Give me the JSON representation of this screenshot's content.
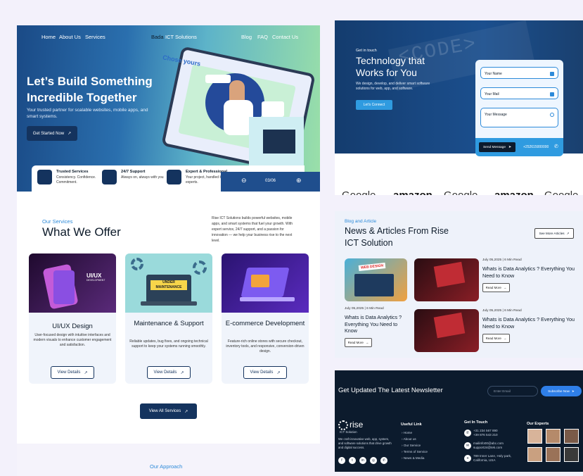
{
  "nav": {
    "home": "Home",
    "about": "About Us",
    "services": "Services",
    "brand_prefix": "Bada",
    "brand": "ICT Solutions",
    "blog": "Blog",
    "faq": "FAQ",
    "contact": "Contact Us"
  },
  "hero": {
    "title": "Let’s Build Something Incredible Together",
    "subtitle": "Your trusted partner for scalable websites, mobile apps, and smart systems.",
    "cta": "Get Started Now",
    "art_caption": "Chose yours"
  },
  "features": [
    {
      "title": "Trusted Services",
      "desc": "Consistency. Confidence. Commitment."
    },
    {
      "title": "24/7 Support",
      "desc": "Always on, always with you"
    },
    {
      "title": "Expert & Professional",
      "desc": "Your project, handled by experts."
    }
  ],
  "slider": {
    "counter": "03/06"
  },
  "services": {
    "tag": "Our Services",
    "title": "What We Offer",
    "intro": "Rise ICT Solutions builds powerful websites, mobile apps, and smart systems that fuel your growth. With expert service, 24/7 support, and a passion for innovation — we help your business rise to the next level.",
    "view_all": "View All Services",
    "cards": [
      {
        "title": "UI/UX Design",
        "desc": "User-focused design with intuitive interfaces and modern visuals to enhance customer engagement and satisfaction.",
        "button": "View Details",
        "img_label": "UI/UX",
        "img_sub": "DEVELOPMENT",
        "color": "#3a1550"
      },
      {
        "title": "Maintenance & Support",
        "desc": "Reliable updates, bug fixes, and ongoing technical support to keep your systems running smoothly.",
        "button": "View Details",
        "img_label": "UNDER MAINTENANCE",
        "color": "#8fd3d6"
      },
      {
        "title": "E-commerce Development",
        "desc": "Feature-rich online stores with secure checkout, inventory tools, and responsive, conversion-driven design.",
        "button": "View Details",
        "color": "#3a1a8a"
      }
    ]
  },
  "approach": {
    "tag": "Our Approach"
  },
  "contact_hero": {
    "tag": "Get in touch",
    "title": "Technology that Works for You",
    "desc": "We design, develop, and deliver smart software solutions for web, app, and software.",
    "cta": "Let's Connect",
    "bg_text": "<CODE>",
    "form": {
      "name": "Your Name",
      "mail": "Your Mail",
      "message": "Your Message",
      "send": "Send Message",
      "phone": "+252615000000"
    }
  },
  "logos": [
    "Google",
    "amazon",
    "Google",
    "amazon",
    "Google"
  ],
  "blog": {
    "tag": "Blog and Article",
    "title": "News & Articles From Rise ICT Solution",
    "see_more": "See More Articles",
    "read_more": "Read More",
    "posts": [
      {
        "meta": "July 05,2025   |   6 Min Read",
        "title": "Whats is Data Analytics ? Everything You Need to Know",
        "img_label": "WEB DESIGN"
      },
      {
        "meta": "July 05,2025   |   6 Min Read",
        "title": "Whats is Data Analytics ? Everything You Need to Know"
      },
      {
        "meta": "July 05,2025   |   6 Min Read",
        "title": "Whats is Data Analytics ? Everything You Need to Know"
      }
    ]
  },
  "newsletter": {
    "title": "Get Updated The Latest Newsletter",
    "placeholder": "Enter Email",
    "button": "Subscribe Now"
  },
  "footer": {
    "logo": "rise",
    "logo_sub": "ICT Solution",
    "about": "We craft innovative web, app, system, and software solutions that drive growth and digital success.",
    "useful_title": "Useful Link",
    "links": [
      "Home",
      "About us",
      "Our Service",
      "Terms of Service",
      "News & Media"
    ],
    "touch_title": "Get In Touch",
    "phone1": "+31 234 567 890",
    "phone2": "+39 876 543 210",
    "mail1": "mailinfo00@abc.com",
    "mail2": "support24@tek.com",
    "address1": "789 Inner Lane, Holy park,",
    "address2": "California, USA",
    "experts_title": "Our Experts"
  }
}
